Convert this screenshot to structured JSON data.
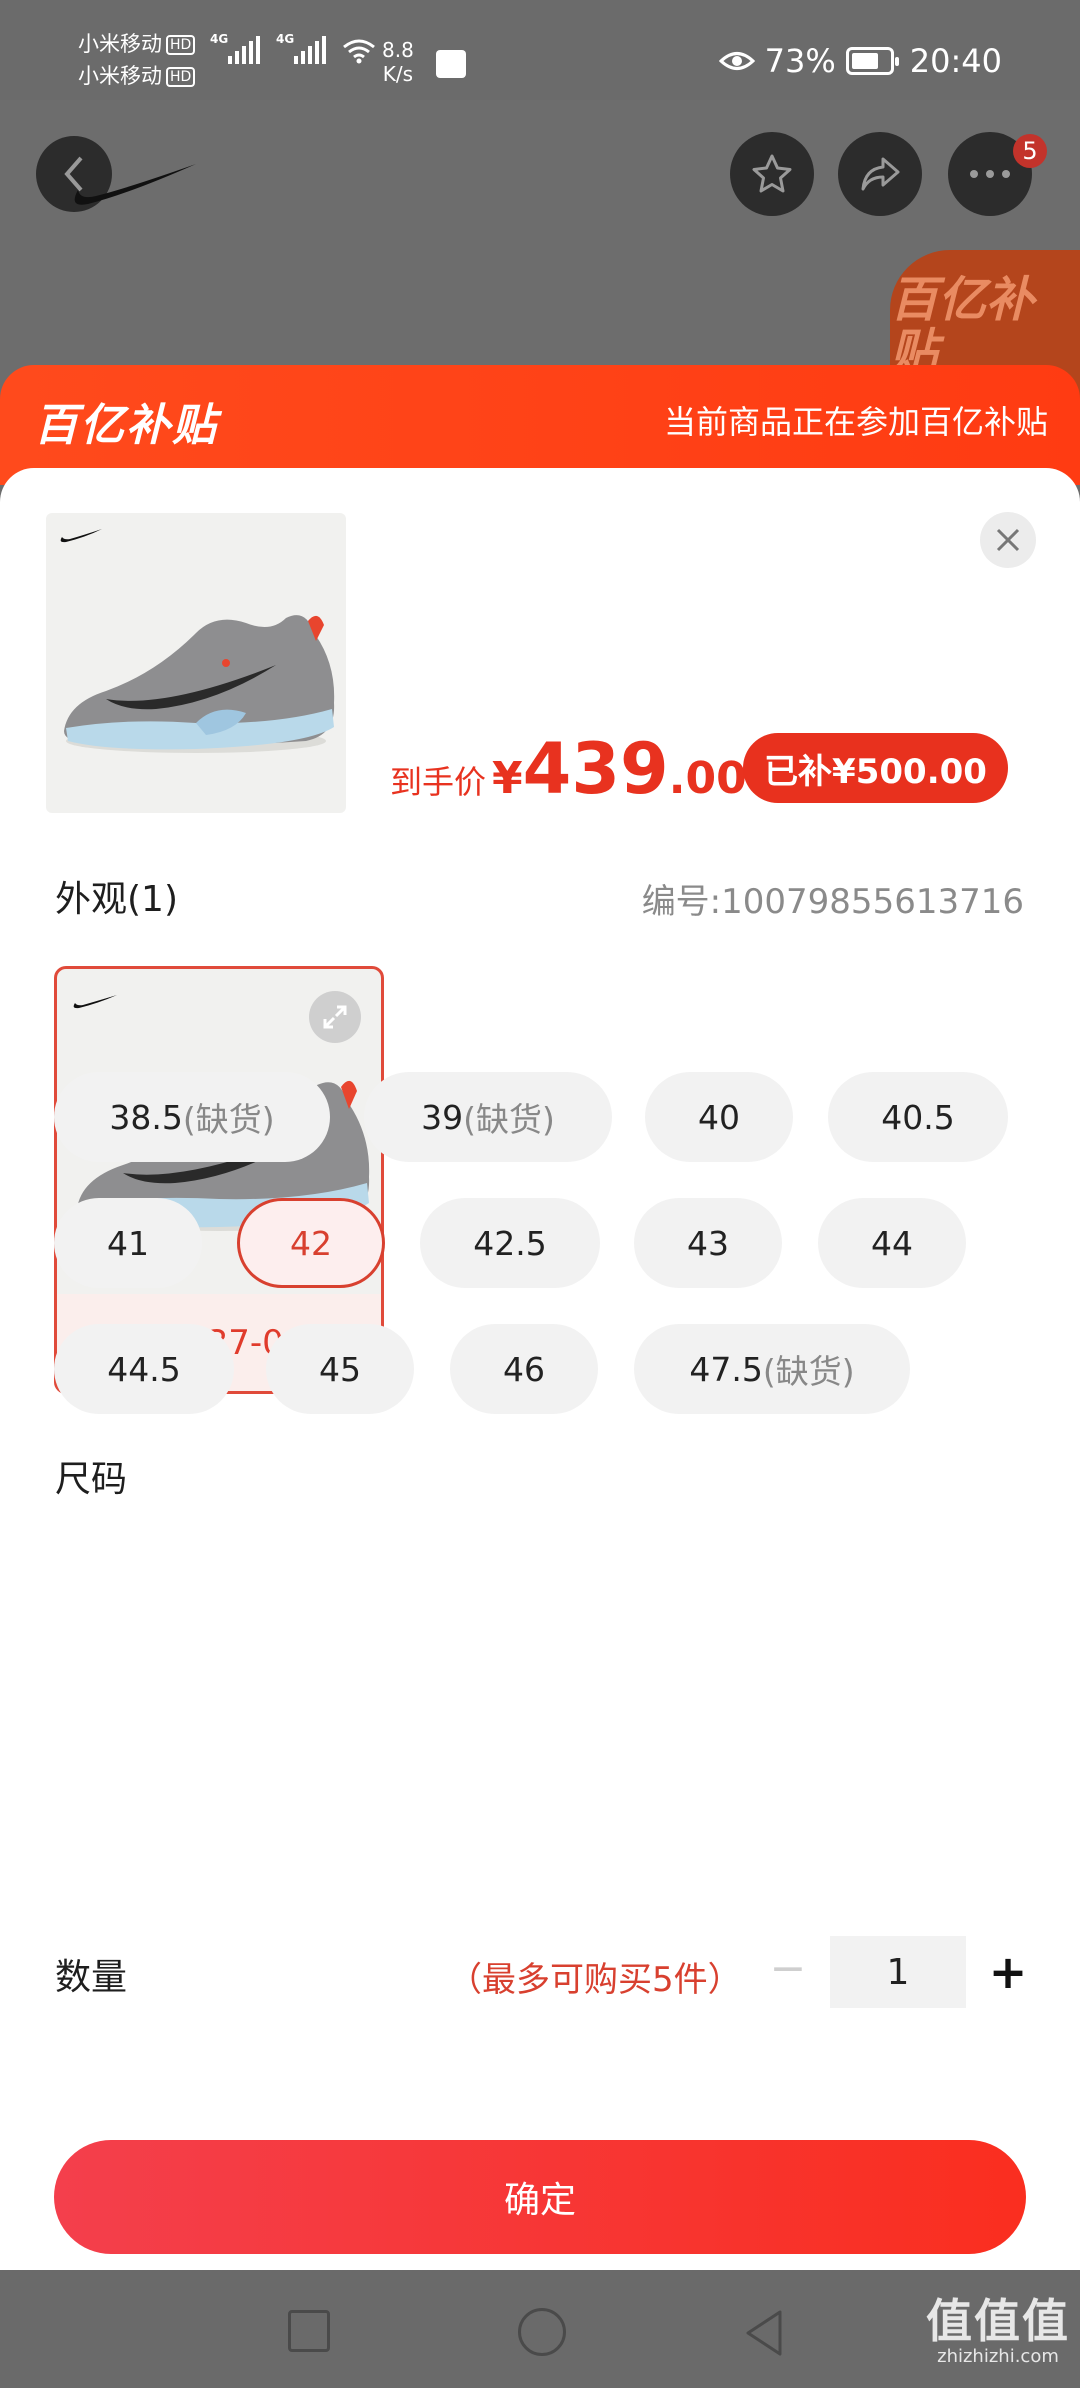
{
  "status_bar": {
    "carrier1": "小米移动",
    "carrier2": "小米移动",
    "hd": "HD",
    "net": "4G",
    "speed_value": "8.8",
    "speed_unit": "K/s",
    "battery": "73%",
    "battery_level": 0.73,
    "time": "20:40"
  },
  "header": {
    "cart_badge": "5",
    "promo_corner": "百亿补贴"
  },
  "banner": {
    "logo": "百亿补贴",
    "note": "当前商品正在参加百亿补贴"
  },
  "product": {
    "price_label": "到手价",
    "currency": "¥",
    "price_int": "439",
    "price_dec": ".00",
    "subsidy": "已补¥500.00"
  },
  "appearance": {
    "title": "外观(1)",
    "sku": "编号:10079855613716",
    "variants": [
      {
        "label": "DD2737-002"
      }
    ]
  },
  "size": {
    "title": "尺码",
    "options": [
      {
        "value": "38.5",
        "note": "(缺货)"
      },
      {
        "value": "39",
        "note": "(缺货)"
      },
      {
        "value": "40",
        "note": ""
      },
      {
        "value": "40.5",
        "note": ""
      },
      {
        "value": "41",
        "note": ""
      },
      {
        "value": "42",
        "note": ""
      },
      {
        "value": "42.5",
        "note": ""
      },
      {
        "value": "43",
        "note": ""
      },
      {
        "value": "44",
        "note": ""
      },
      {
        "value": "44.5",
        "note": ""
      },
      {
        "value": "45",
        "note": ""
      },
      {
        "value": "46",
        "note": ""
      },
      {
        "value": "47.5",
        "note": "(缺货)"
      }
    ],
    "selected": "42"
  },
  "quantity": {
    "title": "数量",
    "limit": "（最多可购买5件）",
    "minus": "−",
    "value": "1",
    "plus": "+"
  },
  "confirm_label": "确定",
  "watermark": {
    "big": "值值值",
    "small": "zhizhizhi.com"
  },
  "colors": {
    "accent": "#e8321f",
    "banner": "#ff4a1c"
  }
}
